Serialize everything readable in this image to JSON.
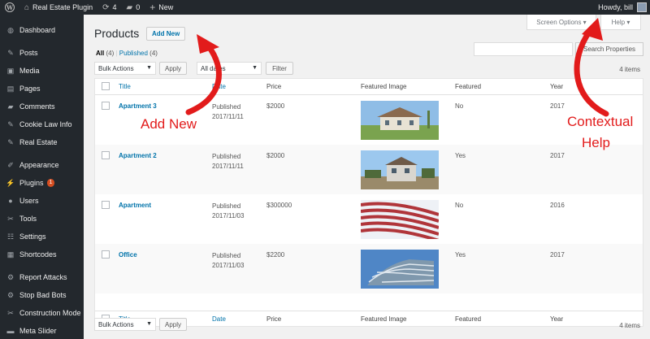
{
  "adminbar": {
    "site_name": "Real Estate Plugin",
    "updates_count": "4",
    "comments_count": "0",
    "new_label": "New",
    "howdy": "Howdy, bill"
  },
  "sidebar": {
    "items": [
      {
        "label": "Dashboard",
        "icon": "dashboard-icon",
        "glyph": "◍"
      },
      {
        "label": "Posts",
        "icon": "pin-icon",
        "glyph": "✎"
      },
      {
        "label": "Media",
        "icon": "media-icon",
        "glyph": "▣"
      },
      {
        "label": "Pages",
        "icon": "pages-icon",
        "glyph": "▤"
      },
      {
        "label": "Comments",
        "icon": "comment-icon",
        "glyph": "▰"
      },
      {
        "label": "Cookie Law Info",
        "icon": "pin-icon",
        "glyph": "✎"
      },
      {
        "label": "Real Estate",
        "icon": "pin-icon",
        "glyph": "✎"
      },
      {
        "label": "Appearance",
        "icon": "brush-icon",
        "glyph": "✐"
      },
      {
        "label": "Plugins",
        "icon": "plugin-icon",
        "glyph": "⚡",
        "badge": "1"
      },
      {
        "label": "Users",
        "icon": "user-icon",
        "glyph": "●"
      },
      {
        "label": "Tools",
        "icon": "wrench-icon",
        "glyph": "✂"
      },
      {
        "label": "Settings",
        "icon": "settings-icon",
        "glyph": "☷"
      },
      {
        "label": "Shortcodes",
        "icon": "shortcode-icon",
        "glyph": "▦"
      },
      {
        "label": "Report Attacks",
        "icon": "gear-icon",
        "glyph": "⚙"
      },
      {
        "label": "Stop Bad Bots",
        "icon": "gear-icon",
        "glyph": "⚙"
      },
      {
        "label": "Construction Mode",
        "icon": "wrench-icon",
        "glyph": "✂"
      },
      {
        "label": "Meta Slider",
        "icon": "slider-icon",
        "glyph": "▬"
      }
    ]
  },
  "screen_options_label": "Screen Options ▾",
  "help_label": "Help ▾",
  "page_title": "Products",
  "add_new_label": "Add New",
  "filters": {
    "all_label": "All",
    "all_count": "(4)",
    "separator": "|",
    "published_label": "Published",
    "published_count": "(4)"
  },
  "search_button_label": "Search Properties",
  "bulk_actions_label": "Bulk Actions",
  "apply_label": "Apply",
  "all_dates_label": "All dates",
  "filter_label": "Filter",
  "items_count": "4 items",
  "columns": {
    "title": "Title",
    "date": "Date",
    "price": "Price",
    "featured_image": "Featured Image",
    "featured": "Featured",
    "year": "Year"
  },
  "rows": [
    {
      "title": "Apartment 3",
      "status": "Published",
      "date": "2017/11/11",
      "price": "$2000",
      "featured": "No",
      "year": "2017"
    },
    {
      "title": "Apartment 2",
      "status": "Published",
      "date": "2017/11/11",
      "price": "$2000",
      "featured": "Yes",
      "year": "2017"
    },
    {
      "title": "Apartment",
      "status": "Published",
      "date": "2017/11/03",
      "price": "$300000",
      "featured": "No",
      "year": "2016"
    },
    {
      "title": "Office",
      "status": "Published",
      "date": "2017/11/03",
      "price": "$2200",
      "featured": "Yes",
      "year": "2017"
    }
  ],
  "annotations": {
    "add_new": "Add New",
    "contextual_1": "Contextual",
    "contextual_2": "Help"
  },
  "colors": {
    "admin_dark": "#23282d",
    "link_blue": "#0073aa",
    "annotation_red": "#e21b1b"
  }
}
